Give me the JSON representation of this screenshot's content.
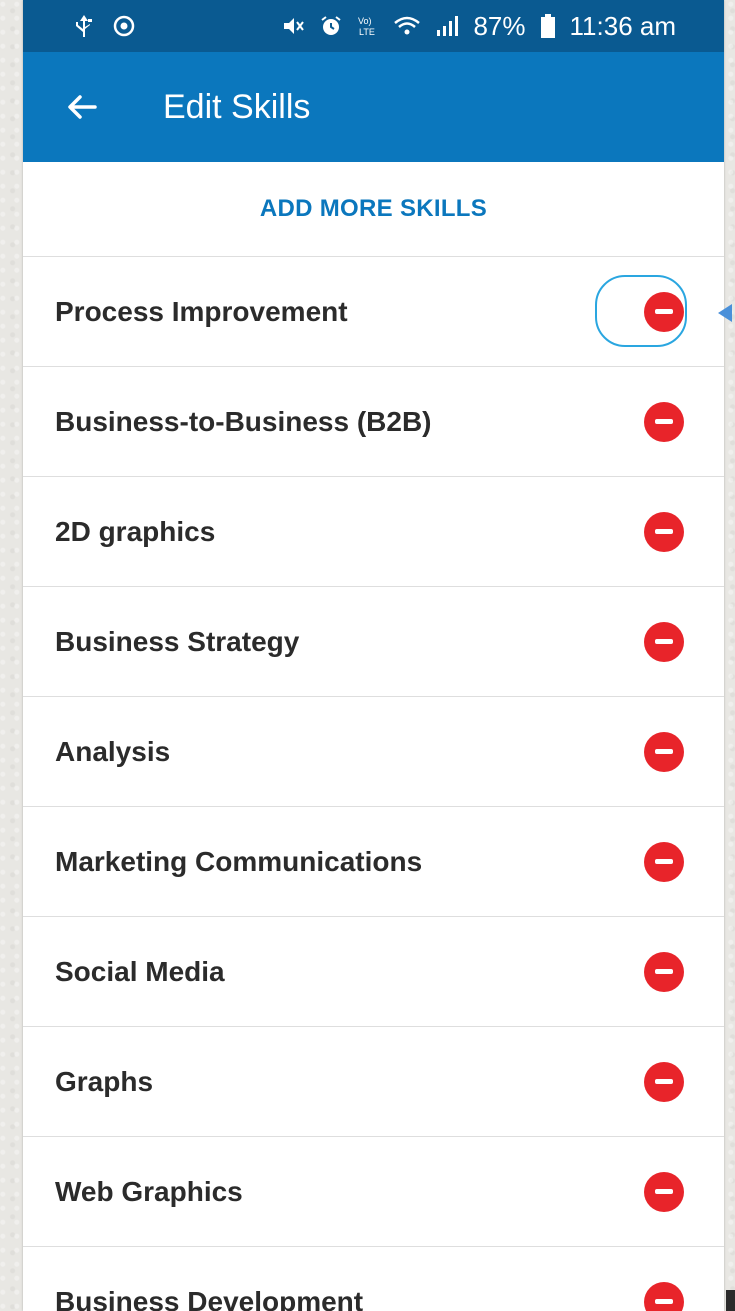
{
  "status_bar": {
    "time": "11:36 am",
    "battery": "87%",
    "left_icons": [
      "usb-icon",
      "sync-icon"
    ],
    "right_icons": [
      "mute-icon",
      "alarm-icon",
      "volte-icon",
      "wifi-icon",
      "signal-icon",
      "battery-icon"
    ],
    "volte_text": "Vo) LTE"
  },
  "header": {
    "title": "Edit Skills",
    "back_icon": "back-arrow-icon"
  },
  "add_more": {
    "label": "ADD MORE SKILLS"
  },
  "skills": [
    {
      "label": "Process Improvement"
    },
    {
      "label": "Business-to-Business (B2B)"
    },
    {
      "label": "2D graphics"
    },
    {
      "label": "Business Strategy"
    },
    {
      "label": "Analysis"
    },
    {
      "label": "Marketing Communications"
    },
    {
      "label": "Social Media"
    },
    {
      "label": "Graphs"
    },
    {
      "label": "Web Graphics"
    },
    {
      "label": "Business Development"
    }
  ],
  "colors": {
    "status_bar": "#0a5a91",
    "app_bar": "#0b77bd",
    "accent_link": "#0b77bd",
    "remove_button": "#e8242a",
    "highlight_ring": "#2aa6e0"
  }
}
